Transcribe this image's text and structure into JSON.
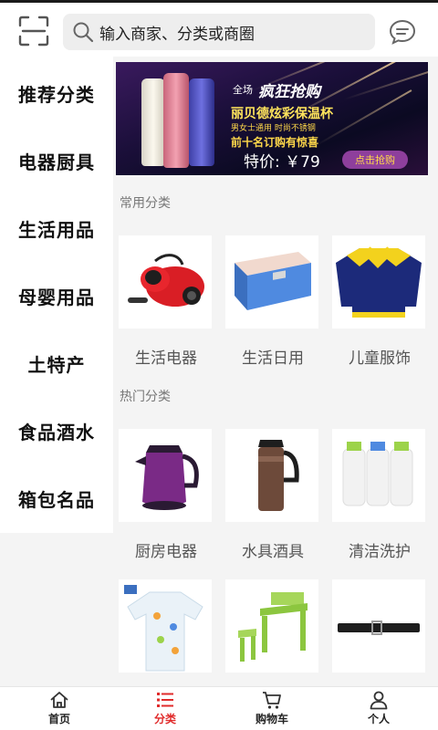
{
  "header": {
    "search_placeholder": "输入商家、分类或商圈"
  },
  "sidebar": {
    "items": [
      {
        "label": "推荐分类"
      },
      {
        "label": "电器厨具"
      },
      {
        "label": "生活用品"
      },
      {
        "label": "母婴用品"
      },
      {
        "label": "土特产"
      },
      {
        "label": "食品酒水"
      },
      {
        "label": "箱包名品"
      }
    ]
  },
  "banner": {
    "sub": "全场",
    "title": "疯狂抢购",
    "product": "丽贝德炫彩保温杯",
    "line1": "男女士通用   时尚不锈钢",
    "line2": "前十名订购有惊喜",
    "price": "特价: ￥79",
    "button": "点击抢购"
  },
  "sections": {
    "common": {
      "title": "常用分类",
      "items": [
        {
          "label": "生活电器"
        },
        {
          "label": "生活日用"
        },
        {
          "label": "儿童服饰"
        }
      ]
    },
    "hot": {
      "title": "热门分类",
      "items": [
        {
          "label": "厨房电器"
        },
        {
          "label": "水具酒具"
        },
        {
          "label": "清洁洗护"
        }
      ]
    }
  },
  "tabbar": {
    "tabs": [
      {
        "label": "首页",
        "icon": "home-icon",
        "active": false
      },
      {
        "label": "分类",
        "icon": "list-icon",
        "active": true
      },
      {
        "label": "购物车",
        "icon": "cart-icon",
        "active": false
      },
      {
        "label": "个人",
        "icon": "person-icon",
        "active": false
      }
    ]
  },
  "colors": {
    "accent": "#e02b2b",
    "panel_bg": "#f4f4f4",
    "search_bg": "#eeeeee"
  }
}
